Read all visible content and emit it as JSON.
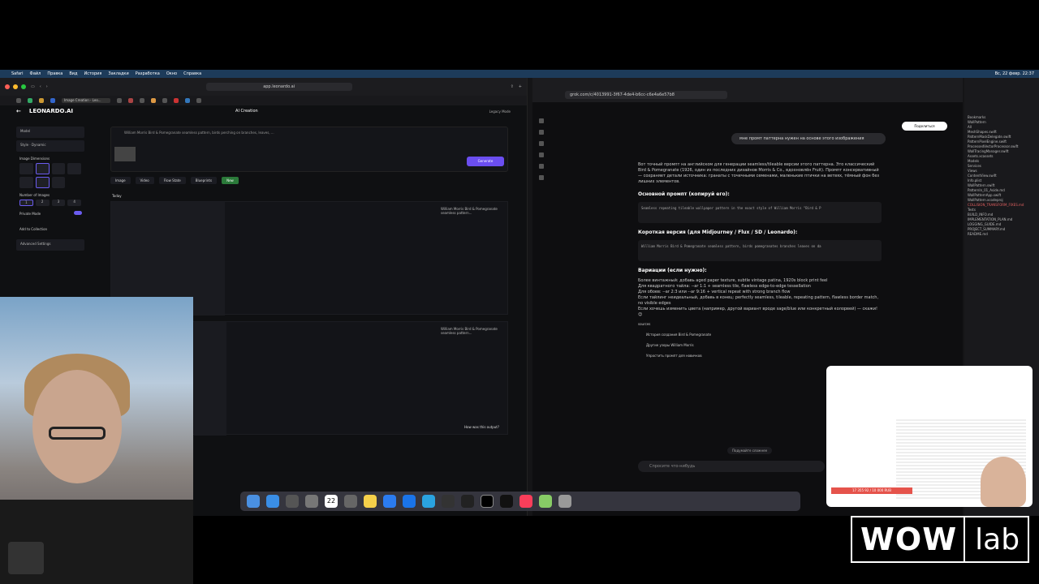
{
  "menubar": {
    "app": "Safari",
    "items": [
      "Файл",
      "Правка",
      "Вид",
      "История",
      "Закладки",
      "Разработка",
      "Окно",
      "Справка"
    ],
    "clock": "Вс, 22 февр. 22:37"
  },
  "left_browser": {
    "url": "app.leonardo.ai",
    "active_tab": "Image Creation - Leo...",
    "brand": "LEONARDO.AI",
    "section_title": "AI Creation",
    "right_label": "Legacy Mode",
    "sidebar": {
      "model_label": "Model",
      "style_label": "Style",
      "style_value": "Dynamic",
      "dimensions_label": "Image Dimensions",
      "num_images_label": "Number of Images",
      "num_values": [
        "1",
        "2",
        "3",
        "4"
      ],
      "private_mode": "Private Mode",
      "add_collection": "Add to Collection",
      "advanced": "Advanced Settings"
    },
    "prompt_text": "William Morris Bird & Pomegranate seamless pattern, birds perching on branches, leaves, ...",
    "generate_button": "Generate",
    "mode_tabs": [
      "Image",
      "Video",
      "Flow State",
      "Blueprints",
      "New"
    ],
    "today_label": "Today",
    "card_caption": "William Morris Bird & Pomegranate seamless pattern...",
    "card_feedback": "How was this output?"
  },
  "right_browser": {
    "url": "grok.com/c/4013991-3f67-4de4-b6cc-c6e4a6e57b8",
    "share_button": "Поделиться",
    "user_message": "мне промт паттерна нужен на основе этого изображения",
    "intro": "Вот точный промпт на английском для генерации seamless/tileable версии этого паттерна. Это классический Bird & Pomegranate (1926, один из последних дизайнов Morris & Co., вдохновлён Fruit). Промпт консервативный — сохраняет детали источника: гранаты с точечными семенами, маленькие птички на ветвях, тёмный фон без лишних элементов.",
    "heading_main": "Основной промпт (копируй его):",
    "code_main": "Seamless repeating tileable wallpaper pattern in the exact style of William Morris \"Bird & P",
    "heading_short": "Короткая версия (для Midjourney / Flux / SD / Leonardo):",
    "code_short": "William Morris Bird & Pomegranate seamless pattern, birds pomegranates branches leaves on da",
    "heading_variations": "Вариации (если нужно):",
    "bullets": [
      "Более винтажный: добавь aged paper texture, subtle vintage patina, 1920s block print feel",
      "Для квадратного тайла: --ar 1:1 + seamless tile, flawless edge-to-edge tessellation",
      "Для обоев: --ar 2:3 или --ar 9:16 + vertical repeat with strong branch flow"
    ],
    "tail": "Если тайлинг неидеальный, добавь в конец: perfectly seamless, tileable, repeating pattern, flawless border match, no visible edges",
    "tail2": "Если хочешь изменить цвета (например, другой вариант вроде sage/blue или конкретный колорвей) — скажи! 😊",
    "sources": "sources",
    "followups": [
      "История создания Bird & Pomegranate",
      "Другие узоры William Morris",
      "Упростить промпт для новичков"
    ],
    "think_hint": "Подумайте сложнее",
    "input_placeholder": "Спросите что-нибудь"
  },
  "right_sidebar": {
    "items": [
      "Bookmarks",
      "WallPattern",
      "All",
      "MeshShapes.swift",
      "PatternMaskDelegate.swift",
      "PatternPixelEngine.swift",
      "ProcessedVectorProcessor.swift",
      "WallTracingManager.swift",
      "Assets.xcassets",
      "Models",
      "Services",
      "Views",
      "ContentView.swift",
      "Info.plist",
      "WallPattern.swift",
      "PatternIn_01_Aside.md",
      "WallPatternApp.swift",
      "WallPattern.xcodeproj",
      "Tests",
      "BUILD_INFO.md",
      "IMPLEMENTATION_PLAN.md",
      "LOGGING_GUIDE.md",
      "PROJECT_SUMMARY.md",
      "README.md"
    ],
    "error_item": "COLLISION_TRANSFORM_FIXES.md"
  },
  "dock_icons": [
    "finder-icon",
    "safari-icon",
    "launchpad-icon",
    "settings-icon",
    "calendar-icon",
    "app-icon",
    "notes-icon",
    "appstore-icon",
    "xcode-icon",
    "telegram-icon",
    "chatgpt-icon",
    "cursor-icon",
    "terminal-icon",
    "github-icon",
    "music-icon",
    "photos-icon",
    "trash-icon"
  ],
  "dock_calendar": "22",
  "pip": {
    "progress_text": "17 355 92 / 10 000 RUB"
  },
  "watermark": {
    "wow": "WOW",
    "lab": "lab"
  }
}
